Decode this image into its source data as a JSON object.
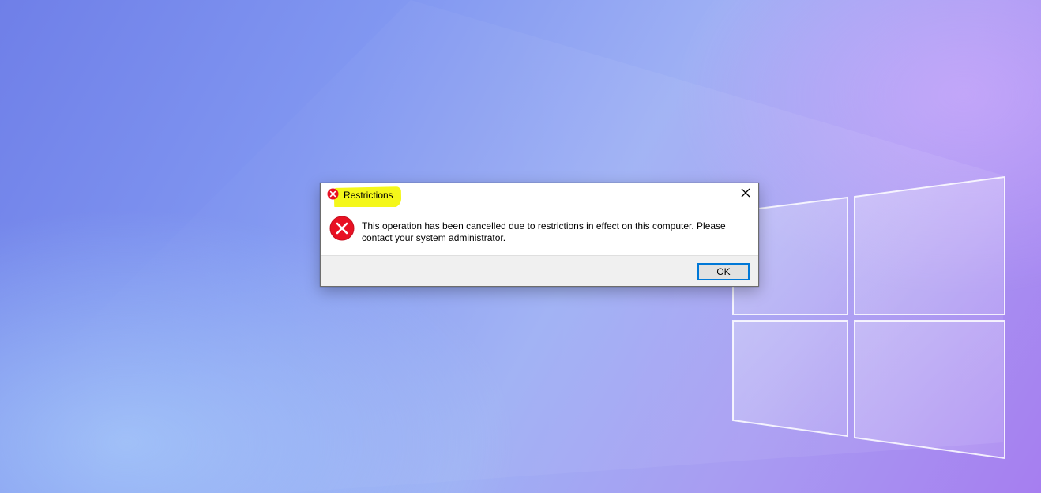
{
  "dialog": {
    "title": "Restrictions",
    "title_icon": "error-icon",
    "message_icon": "error-icon",
    "message": "This operation has been cancelled due to restrictions in effect on this computer. Please contact your system administrator.",
    "close_icon": "close-icon",
    "ok_label": "OK"
  },
  "colors": {
    "error_red": "#e81123",
    "title_highlight": "#f4f71a",
    "button_focus_border": "#0078d7",
    "footer_background": "#f0f0f0"
  }
}
